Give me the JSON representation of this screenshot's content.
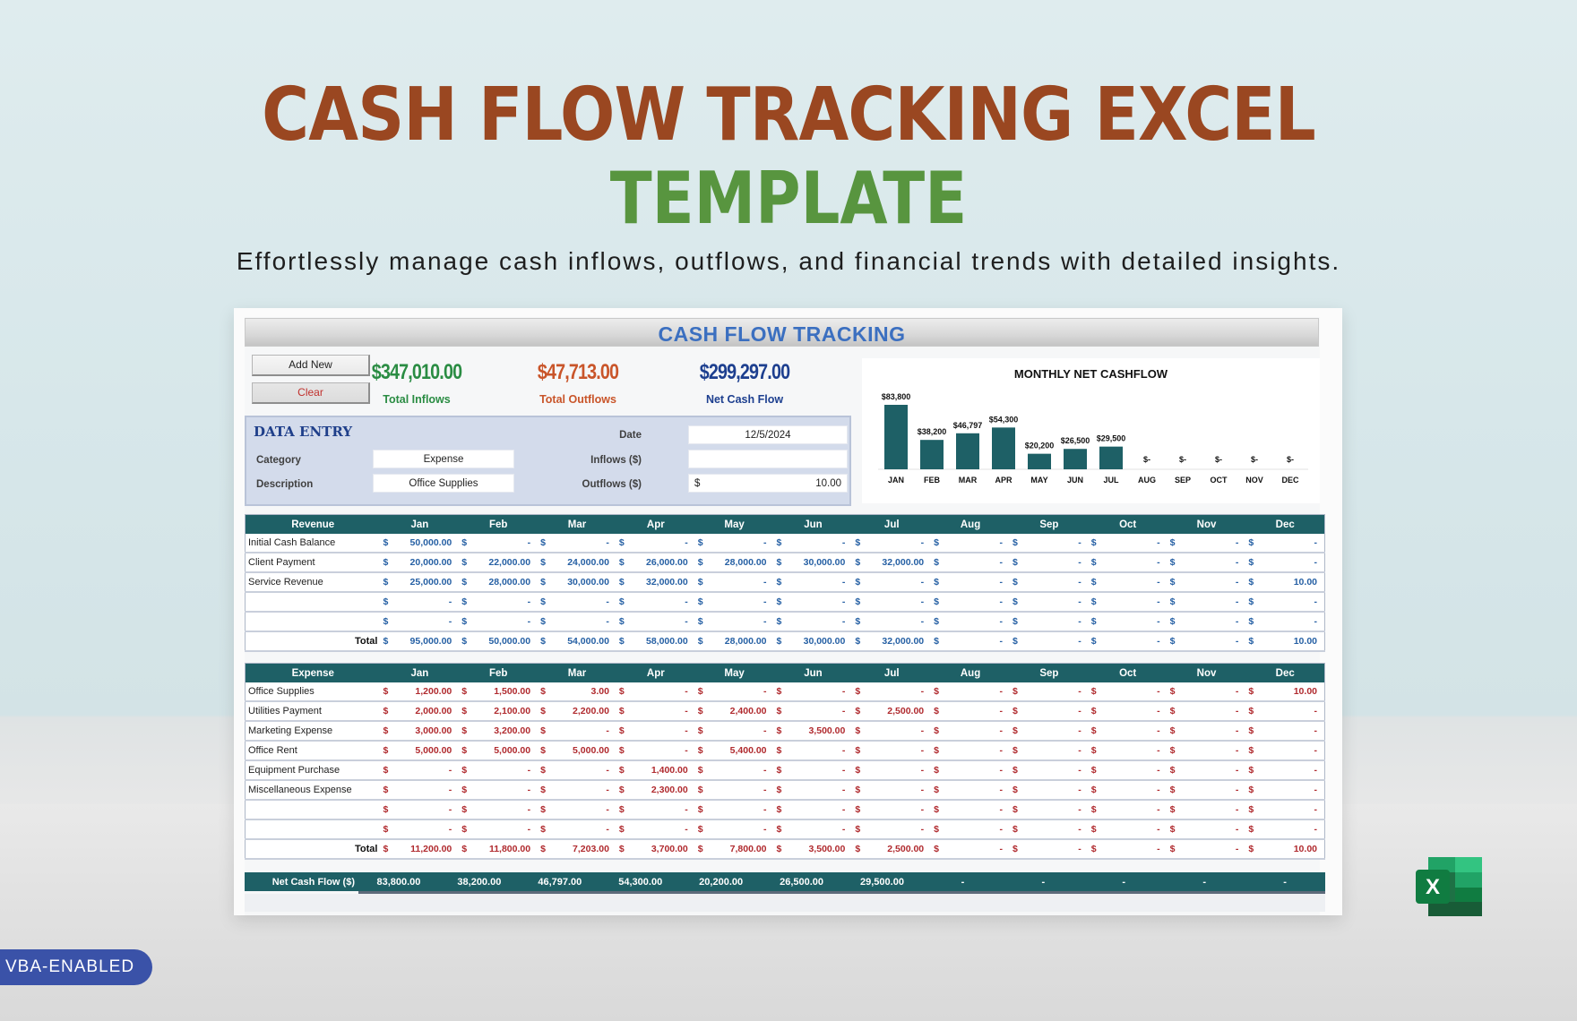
{
  "banner": {
    "title_line1": "CASH FLOW TRACKING EXCEL",
    "title_line2": "TEMPLATE",
    "subtitle": "Effortlessly manage cash inflows, outflows, and financial trends with detailed insights.",
    "badge": "VBA-ENABLED",
    "app_icon": "excel-icon",
    "colors": {
      "title1": "#9a4721",
      "title2": "#58953f",
      "badge": "#3a52a8"
    }
  },
  "sheet": {
    "header_title": "CASH FLOW TRACKING",
    "buttons": {
      "add_new": "Add New",
      "clear": "Clear"
    },
    "kpis": [
      {
        "value": "$347,010.00",
        "label": "Total Inflows",
        "color": "#2a8c43"
      },
      {
        "value": "$47,713.00",
        "label": "Total Outflows",
        "color": "#c9552a"
      },
      {
        "value": "$299,297.00",
        "label": "Net Cash Flow",
        "color": "#1d3f8f"
      }
    ],
    "data_entry": {
      "title": "DATA ENTRY",
      "category_label": "Category",
      "category_value": "Expense",
      "description_label": "Description",
      "description_value": "Office Supplies",
      "date_label": "Date",
      "date_value": "12/5/2024",
      "inflows_label": "Inflows ($)",
      "inflows_value": "",
      "outflows_label": "Outflows ($)",
      "outflows_currency": "$",
      "outflows_value": "10.00"
    },
    "months": [
      "Jan",
      "Feb",
      "Mar",
      "Apr",
      "May",
      "Jun",
      "Jul",
      "Aug",
      "Sep",
      "Oct",
      "Nov",
      "Dec"
    ],
    "currency_symbol": "$",
    "revenue": {
      "header": "Revenue",
      "rows": [
        {
          "name": "Initial Cash Balance",
          "values": [
            "50,000.00",
            "-",
            "-",
            "-",
            "-",
            "-",
            "-",
            "-",
            "-",
            "-",
            "-",
            "-"
          ]
        },
        {
          "name": "Client Payment",
          "values": [
            "20,000.00",
            "22,000.00",
            "24,000.00",
            "26,000.00",
            "28,000.00",
            "30,000.00",
            "32,000.00",
            "-",
            "-",
            "-",
            "-",
            "-"
          ]
        },
        {
          "name": "Service Revenue",
          "values": [
            "25,000.00",
            "28,000.00",
            "30,000.00",
            "32,000.00",
            "-",
            "-",
            "-",
            "-",
            "-",
            "-",
            "-",
            "10.00"
          ]
        },
        {
          "name": "",
          "values": [
            "-",
            "-",
            "-",
            "-",
            "-",
            "-",
            "-",
            "-",
            "-",
            "-",
            "-",
            "-"
          ]
        },
        {
          "name": "",
          "values": [
            "-",
            "-",
            "-",
            "-",
            "-",
            "-",
            "-",
            "-",
            "-",
            "-",
            "-",
            "-"
          ]
        }
      ],
      "total_label": "Total",
      "totals": [
        "95,000.00",
        "50,000.00",
        "54,000.00",
        "58,000.00",
        "28,000.00",
        "30,000.00",
        "32,000.00",
        "-",
        "-",
        "-",
        "-",
        "10.00"
      ]
    },
    "expense": {
      "header": "Expense",
      "rows": [
        {
          "name": "Office Supplies",
          "values": [
            "1,200.00",
            "1,500.00",
            "3.00",
            "-",
            "-",
            "-",
            "-",
            "-",
            "-",
            "-",
            "-",
            "10.00"
          ]
        },
        {
          "name": "Utilities Payment",
          "values": [
            "2,000.00",
            "2,100.00",
            "2,200.00",
            "-",
            "2,400.00",
            "-",
            "2,500.00",
            "-",
            "-",
            "-",
            "-",
            "-"
          ]
        },
        {
          "name": "Marketing Expense",
          "values": [
            "3,000.00",
            "3,200.00",
            "-",
            "-",
            "-",
            "3,500.00",
            "-",
            "-",
            "-",
            "-",
            "-",
            "-"
          ]
        },
        {
          "name": "Office Rent",
          "values": [
            "5,000.00",
            "5,000.00",
            "5,000.00",
            "-",
            "5,400.00",
            "-",
            "-",
            "-",
            "-",
            "-",
            "-",
            "-"
          ]
        },
        {
          "name": "Equipment Purchase",
          "values": [
            "-",
            "-",
            "-",
            "1,400.00",
            "-",
            "-",
            "-",
            "-",
            "-",
            "-",
            "-",
            "-"
          ]
        },
        {
          "name": "Miscellaneous Expense",
          "values": [
            "-",
            "-",
            "-",
            "2,300.00",
            "-",
            "-",
            "-",
            "-",
            "-",
            "-",
            "-",
            "-"
          ]
        },
        {
          "name": "",
          "values": [
            "-",
            "-",
            "-",
            "-",
            "-",
            "-",
            "-",
            "-",
            "-",
            "-",
            "-",
            "-"
          ]
        },
        {
          "name": "",
          "values": [
            "-",
            "-",
            "-",
            "-",
            "-",
            "-",
            "-",
            "-",
            "-",
            "-",
            "-",
            "-"
          ]
        }
      ],
      "total_label": "Total",
      "totals": [
        "11,200.00",
        "11,800.00",
        "7,203.00",
        "3,700.00",
        "7,800.00",
        "3,500.00",
        "2,500.00",
        "-",
        "-",
        "-",
        "-",
        "10.00"
      ]
    },
    "net_cash_flow": {
      "label": "Net Cash Flow ($)",
      "values": [
        "83,800.00",
        "38,200.00",
        "46,797.00",
        "54,300.00",
        "20,200.00",
        "26,500.00",
        "29,500.00",
        "-",
        "-",
        "-",
        "-",
        "-"
      ]
    }
  },
  "chart_data": {
    "type": "bar",
    "title": "MONTHLY NET CASHFLOW",
    "categories": [
      "JAN",
      "FEB",
      "MAR",
      "APR",
      "MAY",
      "JUN",
      "JUL",
      "AUG",
      "SEP",
      "OCT",
      "NOV",
      "DEC"
    ],
    "values": [
      83800,
      38200,
      46797,
      54300,
      20200,
      26500,
      29500,
      0,
      0,
      0,
      0,
      0
    ],
    "data_labels": [
      "$83,800",
      "$38,200",
      "$46,797",
      "$54,300",
      "$20,200",
      "$26,500",
      "$29,500",
      "$-",
      "$-",
      "$-",
      "$-",
      "$-"
    ],
    "xlabel": "",
    "ylabel": "",
    "ylim": [
      0,
      90000
    ],
    "grid": false,
    "legend": "none",
    "bar_color": "#1e6066"
  }
}
